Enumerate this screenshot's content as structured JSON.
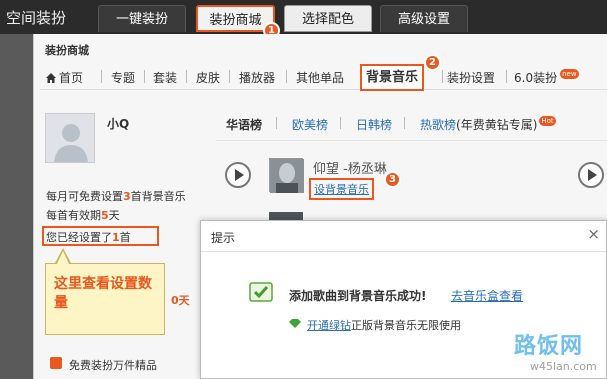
{
  "app_title": "空间装扮",
  "top_tabs": [
    {
      "label": "一键装扮"
    },
    {
      "label": "装扮商城",
      "marker": "1"
    },
    {
      "label": "选择配色"
    },
    {
      "label": "高级设置"
    }
  ],
  "section_title": "装扮商城",
  "nav": {
    "home": "首页",
    "items": [
      "专题",
      "套装",
      "皮肤",
      "播放器",
      "其他单品",
      "背景音乐",
      "装扮设置",
      "6.0装扮"
    ],
    "highlight_marker": "2",
    "new_badge": "new"
  },
  "profile": {
    "username": "小Q",
    "monthly_prefix": "每月可免费设置",
    "monthly_count": "3",
    "monthly_suffix": "首背景音乐",
    "validity_prefix": "每首有效期",
    "validity_days": "5",
    "validity_suffix": "天",
    "set_prefix": "您已经设置了",
    "set_count": "1",
    "set_suffix": "首",
    "partial_day": "0天",
    "free_link": "免费装扮万件精品"
  },
  "callout": {
    "text": "这里查看设置数量"
  },
  "chart_tabs": {
    "items": [
      "华语榜",
      "欧美榜",
      "日韩榜",
      "热歌榜"
    ],
    "hot_suffix": "(年费黄钻专属)",
    "hot_badge": "Hot"
  },
  "song": {
    "title": "仰望 -杨丞琳",
    "set_link": "设背景音乐",
    "marker": "3"
  },
  "dialog": {
    "title": "提示",
    "close": "×",
    "success": "添加歌曲到背景音乐成功!",
    "view_link": "去音乐盒查看",
    "vip_link": "开通绿钻",
    "vip_text": "正版背景音乐无限使用"
  },
  "watermark": {
    "brand": "路饭网",
    "url": "w45lan.com"
  },
  "colors": {
    "accent": "#e8581f",
    "link": "#2a6eb5",
    "topbar": "#2b2b2b"
  }
}
